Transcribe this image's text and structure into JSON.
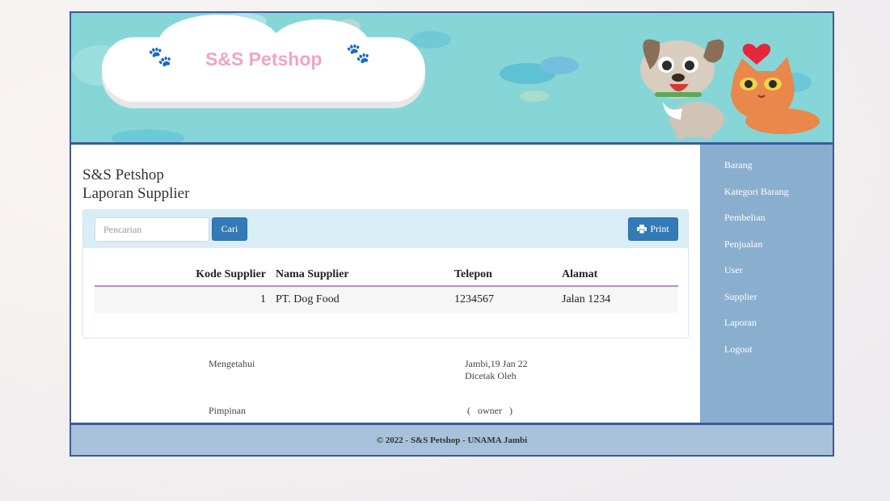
{
  "banner": {
    "brand": "S&S Petshop"
  },
  "content": {
    "site_title": "S&S Petshop",
    "report_title": "Laporan Supplier",
    "search": {
      "placeholder": "Pencarian",
      "button_label": "Cari"
    },
    "print_label": "Print",
    "table": {
      "headers": [
        "Kode Supplier",
        "Nama Supplier",
        "Telepon",
        "Alamat"
      ],
      "rows": [
        [
          "1",
          "PT. Dog Food",
          "1234567",
          "Jalan 1234"
        ]
      ]
    },
    "signature": {
      "acknowledged": "Mengetahui",
      "place_date": "Jambi,19 Jan 22",
      "printed_by": "Dicetak Oleh",
      "leader": "Pimpinan",
      "printer": "(   owner   )"
    }
  },
  "sidebar": {
    "items": [
      {
        "label": "Barang"
      },
      {
        "label": "Kategori Barang"
      },
      {
        "label": "Pembelian"
      },
      {
        "label": "Penjualan"
      },
      {
        "label": "User"
      },
      {
        "label": "Supplier"
      },
      {
        "label": "Laporan"
      },
      {
        "label": "Logout"
      }
    ]
  },
  "footer": {
    "text": "© 2022 - S&S Petshop - UNAMA Jambi"
  },
  "colors": {
    "banner": "#86d6d8",
    "brand_pink": "#f1a3c4",
    "sidebar": "#8aaecd",
    "footer": "#a8c2dc",
    "primary_button": "#337ab7",
    "frame_border": "#3b5b9a"
  },
  "icons": {
    "print": "printer-icon",
    "paw": "paw-icon",
    "heart": "heart-icon"
  }
}
